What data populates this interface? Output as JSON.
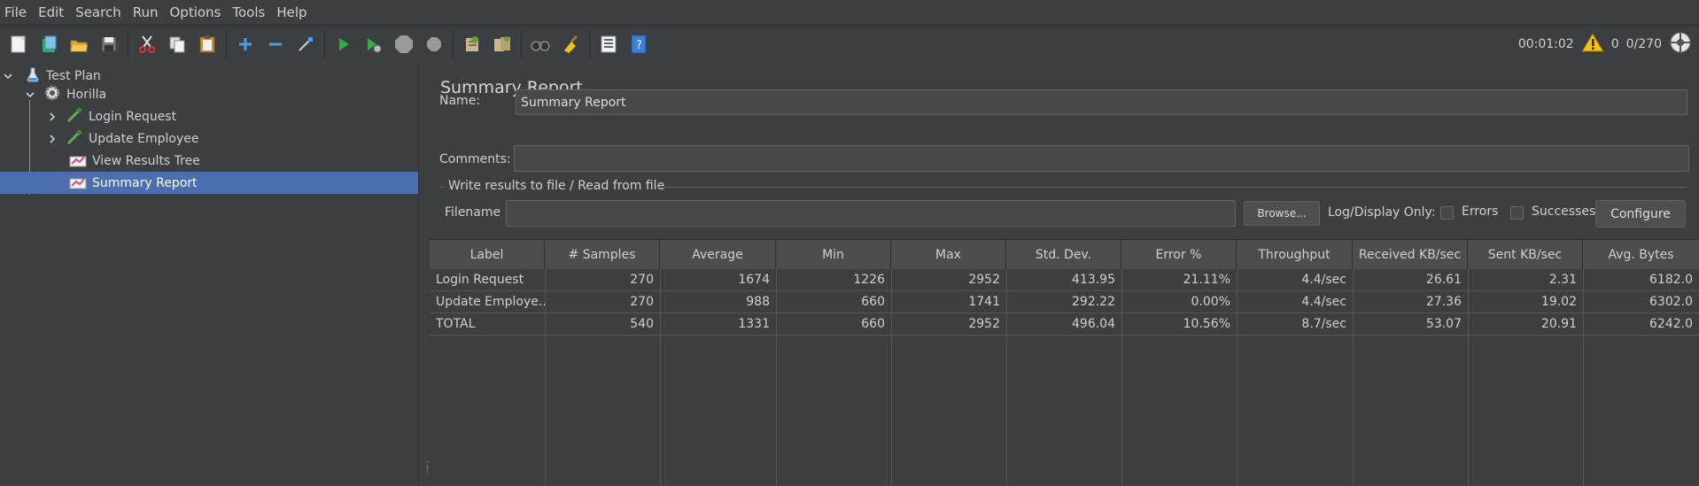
{
  "menubar": {
    "items": [
      "File",
      "Edit",
      "Search",
      "Run",
      "Options",
      "Tools",
      "Help"
    ]
  },
  "toolbar": {
    "icons": [
      "new-template-icon",
      "templates-icon",
      "open-icon",
      "save-icon",
      "cut-icon",
      "copy-icon",
      "paste-icon",
      "expand-icon",
      "collapse-icon",
      "toggle-icon",
      "start-icon",
      "start-no-pause-icon",
      "stop-icon",
      "shutdown-icon",
      "clear-icon",
      "clear-all-icon",
      "search-icon",
      "reset-search-icon",
      "function-helper-icon",
      "help-icon"
    ],
    "timer": "00:01:02",
    "warning_count": "0",
    "threads": "0/270"
  },
  "tree": {
    "items": [
      {
        "label": "Test Plan",
        "icon": "test-plan-icon"
      },
      {
        "label": "Horilla",
        "icon": "thread-group-gear-icon"
      },
      {
        "label": "Login Request",
        "icon": "http-sampler-pipette-icon"
      },
      {
        "label": "Update Employee",
        "icon": "http-sampler-pipette-icon"
      },
      {
        "label": "View Results Tree",
        "icon": "listener-graph-icon"
      },
      {
        "label": "Summary Report",
        "icon": "listener-graph-icon"
      }
    ],
    "selected": "Summary Report"
  },
  "panel": {
    "title": "Summary Report",
    "name_label": "Name:",
    "name_value": "Summary Report",
    "comments_label": "Comments:",
    "comments_value": "",
    "group_title": "Write results to file / Read from file",
    "filename_label": "Filename",
    "filename_value": "",
    "browse_label": "Browse...",
    "log_display_label": "Log/Display Only:",
    "errors_label": "Errors",
    "successes_label": "Successes",
    "configure_label": "Configure"
  },
  "table": {
    "headers": [
      "Label",
      "# Samples",
      "Average",
      "Min",
      "Max",
      "Std. Dev.",
      "Error %",
      "Throughput",
      "Received KB/sec",
      "Sent KB/sec",
      "Avg. Bytes"
    ],
    "rows": [
      [
        "Login Request",
        "270",
        "1674",
        "1226",
        "2952",
        "413.95",
        "21.11%",
        "4.4/sec",
        "26.61",
        "2.31",
        "6182.0"
      ],
      [
        "Update Employe...",
        "270",
        "988",
        "660",
        "1741",
        "292.22",
        "0.00%",
        "4.4/sec",
        "27.36",
        "19.02",
        "6302.0"
      ],
      [
        "TOTAL",
        "540",
        "1331",
        "660",
        "2952",
        "496.04",
        "10.56%",
        "8.7/sec",
        "53.07",
        "20.91",
        "6242.0"
      ]
    ]
  },
  "colors": {
    "background": "#3c3f41",
    "selection": "#4b6eaf",
    "header": "#4a4e50"
  }
}
